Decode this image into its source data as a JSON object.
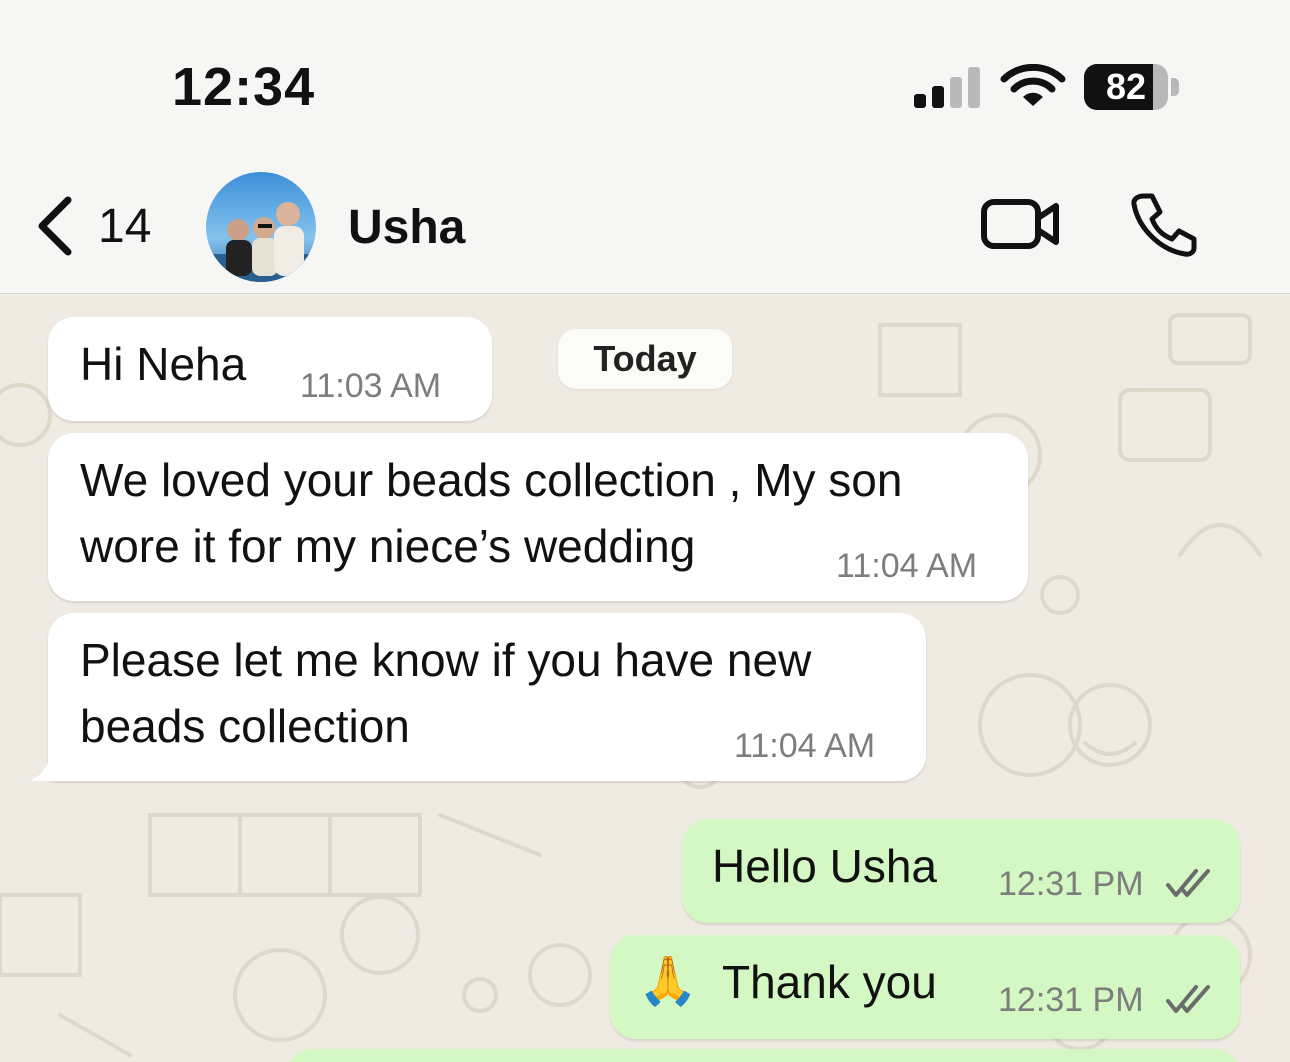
{
  "status_bar": {
    "time": "12:34",
    "battery_level": "82",
    "battery_fraction": 0.82,
    "icons": [
      "signal-icon",
      "wifi-icon",
      "battery-icon"
    ]
  },
  "header": {
    "back_count": "14",
    "contact_name": "Usha",
    "icons": [
      "chevron-left-icon",
      "video-call-icon",
      "phone-icon"
    ]
  },
  "chat": {
    "date_divider": "Today",
    "messages": [
      {
        "direction": "incoming",
        "lines": [
          "Hi Neha"
        ],
        "time": "11:03 AM"
      },
      {
        "direction": "incoming",
        "lines": [
          "We loved your beads collection , My son",
          "wore it for my niece’s wedding"
        ],
        "time": "11:04 AM"
      },
      {
        "direction": "incoming",
        "lines": [
          "Please let me know if you have new",
          "beads collection"
        ],
        "time": "11:04 AM"
      },
      {
        "direction": "outgoing",
        "lines": [
          "Hello Usha"
        ],
        "time": "12:31 PM",
        "status": "read"
      },
      {
        "direction": "outgoing",
        "lines": [
          "Thank you"
        ],
        "emoji": "🙏",
        "time": "12:31 PM",
        "status": "read"
      }
    ]
  },
  "colors": {
    "incoming_bubble": "#ffffff",
    "outgoing_bubble": "#d4f8c4",
    "chat_background": "#efeae2",
    "read_ticks": "#6b6b6b"
  }
}
